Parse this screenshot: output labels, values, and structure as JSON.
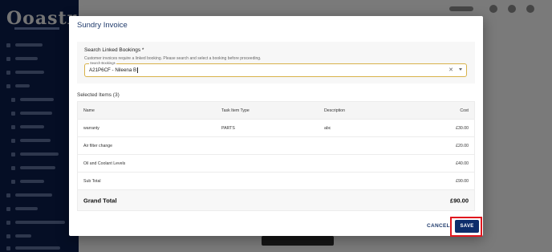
{
  "modal": {
    "title": "Sundry Invoice",
    "linked_bookings": {
      "heading": "Search Linked Bookings *",
      "help_text": "Customer invoices require a linked booking. Please search and select a booking before proceeding.",
      "search_label": "Search Bookings",
      "search_value": "A21P6CF - Nileena B"
    },
    "selected_items_title": "Selected Items (3)",
    "table": {
      "columns": [
        "Name",
        "Task Item Type",
        "Description",
        "Cost"
      ],
      "rows": [
        {
          "name": "warranty",
          "type": "PARTS",
          "description": "abc",
          "cost": "£30.00"
        },
        {
          "name": "Air filter change",
          "type": "",
          "description": "",
          "cost": "£20.00"
        },
        {
          "name": "Oil and Coolant Levels",
          "type": "",
          "description": "",
          "cost": "£40.00"
        }
      ],
      "subtotal_label": "Sub Total",
      "subtotal_value": "£90.00",
      "grand_total_label": "Grand Total",
      "grand_total_value": "£90.00"
    },
    "cancel_label": "CANCEL",
    "save_label": "SAVE"
  },
  "colors": {
    "primary": "#0d2d6b",
    "highlight": "#e0161e",
    "search_border": "#d8b24a"
  },
  "icons": {
    "clear": "close-icon",
    "dropdown": "chevron-down-icon"
  }
}
